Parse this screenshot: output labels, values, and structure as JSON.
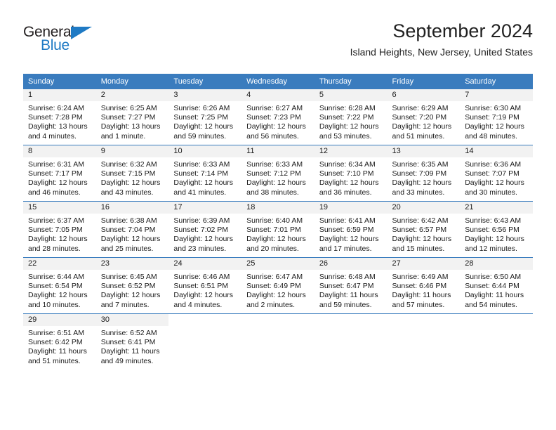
{
  "brand": {
    "name_part1": "General",
    "name_part2": "Blue",
    "accent_color": "#1f7ac4"
  },
  "header": {
    "title": "September 2024",
    "subtitle": "Island Heights, New Jersey, United States"
  },
  "calendar": {
    "header_bg": "#3a7cbe",
    "daynum_bg": "#f2f2f2",
    "weekdays": [
      "Sunday",
      "Monday",
      "Tuesday",
      "Wednesday",
      "Thursday",
      "Friday",
      "Saturday"
    ],
    "weeks": [
      [
        {
          "day": "1",
          "sunrise": "Sunrise: 6:24 AM",
          "sunset": "Sunset: 7:28 PM",
          "daylight_line1": "Daylight: 13 hours",
          "daylight_line2": "and 4 minutes."
        },
        {
          "day": "2",
          "sunrise": "Sunrise: 6:25 AM",
          "sunset": "Sunset: 7:27 PM",
          "daylight_line1": "Daylight: 13 hours",
          "daylight_line2": "and 1 minute."
        },
        {
          "day": "3",
          "sunrise": "Sunrise: 6:26 AM",
          "sunset": "Sunset: 7:25 PM",
          "daylight_line1": "Daylight: 12 hours",
          "daylight_line2": "and 59 minutes."
        },
        {
          "day": "4",
          "sunrise": "Sunrise: 6:27 AM",
          "sunset": "Sunset: 7:23 PM",
          "daylight_line1": "Daylight: 12 hours",
          "daylight_line2": "and 56 minutes."
        },
        {
          "day": "5",
          "sunrise": "Sunrise: 6:28 AM",
          "sunset": "Sunset: 7:22 PM",
          "daylight_line1": "Daylight: 12 hours",
          "daylight_line2": "and 53 minutes."
        },
        {
          "day": "6",
          "sunrise": "Sunrise: 6:29 AM",
          "sunset": "Sunset: 7:20 PM",
          "daylight_line1": "Daylight: 12 hours",
          "daylight_line2": "and 51 minutes."
        },
        {
          "day": "7",
          "sunrise": "Sunrise: 6:30 AM",
          "sunset": "Sunset: 7:19 PM",
          "daylight_line1": "Daylight: 12 hours",
          "daylight_line2": "and 48 minutes."
        }
      ],
      [
        {
          "day": "8",
          "sunrise": "Sunrise: 6:31 AM",
          "sunset": "Sunset: 7:17 PM",
          "daylight_line1": "Daylight: 12 hours",
          "daylight_line2": "and 46 minutes."
        },
        {
          "day": "9",
          "sunrise": "Sunrise: 6:32 AM",
          "sunset": "Sunset: 7:15 PM",
          "daylight_line1": "Daylight: 12 hours",
          "daylight_line2": "and 43 minutes."
        },
        {
          "day": "10",
          "sunrise": "Sunrise: 6:33 AM",
          "sunset": "Sunset: 7:14 PM",
          "daylight_line1": "Daylight: 12 hours",
          "daylight_line2": "and 41 minutes."
        },
        {
          "day": "11",
          "sunrise": "Sunrise: 6:33 AM",
          "sunset": "Sunset: 7:12 PM",
          "daylight_line1": "Daylight: 12 hours",
          "daylight_line2": "and 38 minutes."
        },
        {
          "day": "12",
          "sunrise": "Sunrise: 6:34 AM",
          "sunset": "Sunset: 7:10 PM",
          "daylight_line1": "Daylight: 12 hours",
          "daylight_line2": "and 36 minutes."
        },
        {
          "day": "13",
          "sunrise": "Sunrise: 6:35 AM",
          "sunset": "Sunset: 7:09 PM",
          "daylight_line1": "Daylight: 12 hours",
          "daylight_line2": "and 33 minutes."
        },
        {
          "day": "14",
          "sunrise": "Sunrise: 6:36 AM",
          "sunset": "Sunset: 7:07 PM",
          "daylight_line1": "Daylight: 12 hours",
          "daylight_line2": "and 30 minutes."
        }
      ],
      [
        {
          "day": "15",
          "sunrise": "Sunrise: 6:37 AM",
          "sunset": "Sunset: 7:05 PM",
          "daylight_line1": "Daylight: 12 hours",
          "daylight_line2": "and 28 minutes."
        },
        {
          "day": "16",
          "sunrise": "Sunrise: 6:38 AM",
          "sunset": "Sunset: 7:04 PM",
          "daylight_line1": "Daylight: 12 hours",
          "daylight_line2": "and 25 minutes."
        },
        {
          "day": "17",
          "sunrise": "Sunrise: 6:39 AM",
          "sunset": "Sunset: 7:02 PM",
          "daylight_line1": "Daylight: 12 hours",
          "daylight_line2": "and 23 minutes."
        },
        {
          "day": "18",
          "sunrise": "Sunrise: 6:40 AM",
          "sunset": "Sunset: 7:01 PM",
          "daylight_line1": "Daylight: 12 hours",
          "daylight_line2": "and 20 minutes."
        },
        {
          "day": "19",
          "sunrise": "Sunrise: 6:41 AM",
          "sunset": "Sunset: 6:59 PM",
          "daylight_line1": "Daylight: 12 hours",
          "daylight_line2": "and 17 minutes."
        },
        {
          "day": "20",
          "sunrise": "Sunrise: 6:42 AM",
          "sunset": "Sunset: 6:57 PM",
          "daylight_line1": "Daylight: 12 hours",
          "daylight_line2": "and 15 minutes."
        },
        {
          "day": "21",
          "sunrise": "Sunrise: 6:43 AM",
          "sunset": "Sunset: 6:56 PM",
          "daylight_line1": "Daylight: 12 hours",
          "daylight_line2": "and 12 minutes."
        }
      ],
      [
        {
          "day": "22",
          "sunrise": "Sunrise: 6:44 AM",
          "sunset": "Sunset: 6:54 PM",
          "daylight_line1": "Daylight: 12 hours",
          "daylight_line2": "and 10 minutes."
        },
        {
          "day": "23",
          "sunrise": "Sunrise: 6:45 AM",
          "sunset": "Sunset: 6:52 PM",
          "daylight_line1": "Daylight: 12 hours",
          "daylight_line2": "and 7 minutes."
        },
        {
          "day": "24",
          "sunrise": "Sunrise: 6:46 AM",
          "sunset": "Sunset: 6:51 PM",
          "daylight_line1": "Daylight: 12 hours",
          "daylight_line2": "and 4 minutes."
        },
        {
          "day": "25",
          "sunrise": "Sunrise: 6:47 AM",
          "sunset": "Sunset: 6:49 PM",
          "daylight_line1": "Daylight: 12 hours",
          "daylight_line2": "and 2 minutes."
        },
        {
          "day": "26",
          "sunrise": "Sunrise: 6:48 AM",
          "sunset": "Sunset: 6:47 PM",
          "daylight_line1": "Daylight: 11 hours",
          "daylight_line2": "and 59 minutes."
        },
        {
          "day": "27",
          "sunrise": "Sunrise: 6:49 AM",
          "sunset": "Sunset: 6:46 PM",
          "daylight_line1": "Daylight: 11 hours",
          "daylight_line2": "and 57 minutes."
        },
        {
          "day": "28",
          "sunrise": "Sunrise: 6:50 AM",
          "sunset": "Sunset: 6:44 PM",
          "daylight_line1": "Daylight: 11 hours",
          "daylight_line2": "and 54 minutes."
        }
      ],
      [
        {
          "day": "29",
          "sunrise": "Sunrise: 6:51 AM",
          "sunset": "Sunset: 6:42 PM",
          "daylight_line1": "Daylight: 11 hours",
          "daylight_line2": "and 51 minutes."
        },
        {
          "day": "30",
          "sunrise": "Sunrise: 6:52 AM",
          "sunset": "Sunset: 6:41 PM",
          "daylight_line1": "Daylight: 11 hours",
          "daylight_line2": "and 49 minutes."
        },
        {
          "day": "",
          "sunrise": "",
          "sunset": "",
          "daylight_line1": "",
          "daylight_line2": ""
        },
        {
          "day": "",
          "sunrise": "",
          "sunset": "",
          "daylight_line1": "",
          "daylight_line2": ""
        },
        {
          "day": "",
          "sunrise": "",
          "sunset": "",
          "daylight_line1": "",
          "daylight_line2": ""
        },
        {
          "day": "",
          "sunrise": "",
          "sunset": "",
          "daylight_line1": "",
          "daylight_line2": ""
        },
        {
          "day": "",
          "sunrise": "",
          "sunset": "",
          "daylight_line1": "",
          "daylight_line2": ""
        }
      ]
    ]
  }
}
